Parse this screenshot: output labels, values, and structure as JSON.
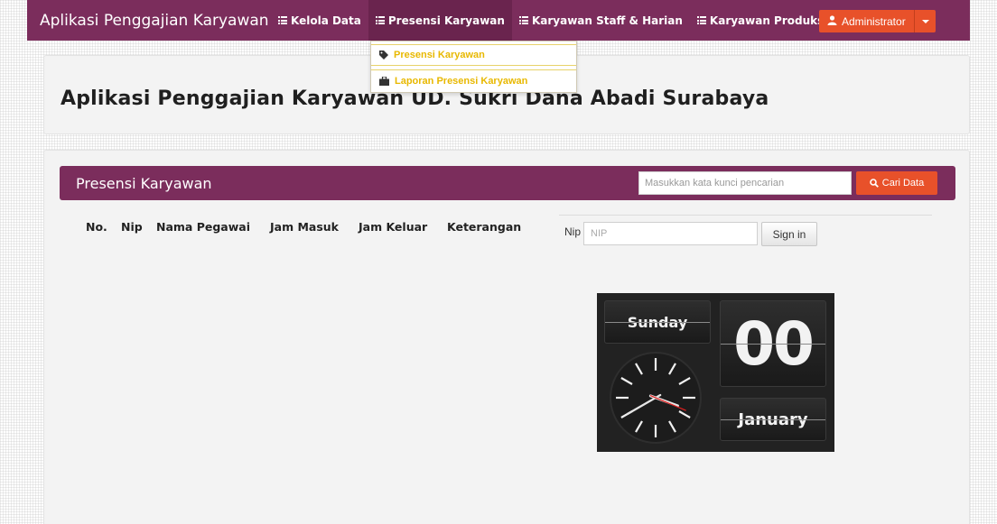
{
  "navbar": {
    "brand": "Aplikasi Penggajian Karyawan",
    "items": [
      {
        "label": "Kelola Data",
        "icon": "list-icon"
      },
      {
        "label": "Presensi Karyawan",
        "icon": "list-icon"
      },
      {
        "label": "Karyawan Staff & Harian",
        "icon": "list-icon"
      },
      {
        "label": "Karyawan Produksi & Borongan",
        "icon": "list-icon"
      }
    ],
    "user": {
      "label": "Administrator",
      "icon": "user-icon"
    }
  },
  "dropdown": {
    "items": [
      {
        "label": "Presensi Karyawan",
        "icon": "tag-icon"
      },
      {
        "label": "Laporan Presensi Karyawan",
        "icon": "briefcase-icon"
      }
    ]
  },
  "hero": {
    "title": "Aplikasi Penggajian Karyawan UD. Sukri Dana Abadi Surabaya"
  },
  "panel": {
    "title": "Presensi Karyawan",
    "search": {
      "placeholder": "Masukkan kata kunci pencarian",
      "button_label": "Cari Data"
    },
    "columns": [
      "No.",
      "Nip",
      "Nama Pegawai",
      "Jam Masuk",
      "Jam Keluar",
      "Keterangan"
    ],
    "rows": []
  },
  "signin": {
    "label": "Nip",
    "placeholder": "NIP",
    "button_label": "Sign in"
  },
  "clock": {
    "day": "Sunday",
    "date": "00",
    "month": "January",
    "time": "15:40"
  },
  "colors": {
    "primary": "#7b2d5c",
    "accent": "#e8512a",
    "dropdown_text": "#e8b800"
  }
}
